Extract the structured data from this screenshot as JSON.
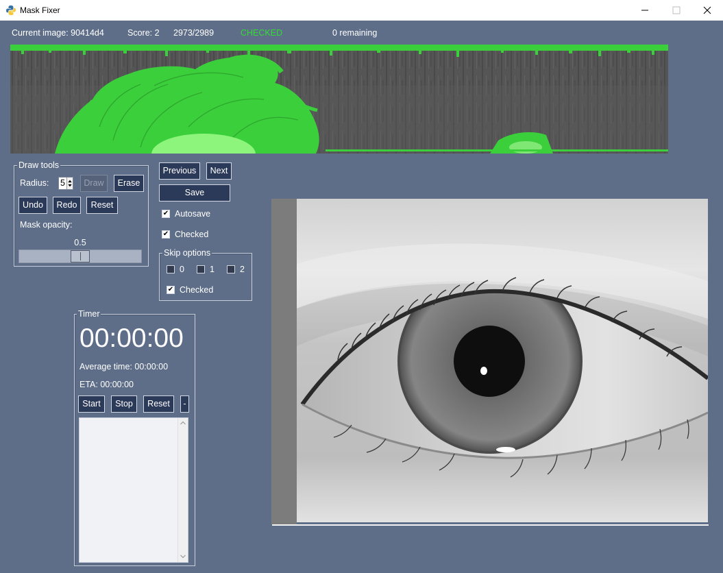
{
  "window": {
    "title": "Mask Fixer"
  },
  "status": {
    "current_image": "Current image: 90414d4",
    "score": "Score: 2",
    "progress": "2973/2989",
    "checked": "CHECKED",
    "remaining": "0 remaining"
  },
  "draw_tools": {
    "title": "Draw tools",
    "radius_label": "Radius:",
    "radius_value": "5",
    "draw": "Draw",
    "erase": "Erase",
    "undo": "Undo",
    "redo": "Redo",
    "reset": "Reset",
    "opacity_label": "Mask opacity:",
    "opacity_value": "0.5",
    "opacity": 0.5
  },
  "navigation": {
    "previous": "Previous",
    "next": "Next",
    "save": "Save",
    "autosave": {
      "label": "Autosave",
      "checked": true
    },
    "checked": {
      "label": "Checked",
      "checked": true
    }
  },
  "skip_options": {
    "title": "Skip options",
    "options": [
      {
        "label": "0",
        "checked": false
      },
      {
        "label": "1",
        "checked": false
      },
      {
        "label": "2",
        "checked": false
      }
    ],
    "checked": {
      "label": "Checked",
      "checked": true
    }
  },
  "timer": {
    "title": "Timer",
    "time": "00:00:00",
    "average": "Average time: 00:00:00",
    "eta": "ETA: 00:00:00",
    "start": "Start",
    "stop": "Stop",
    "reset": "Reset",
    "collapse": "-",
    "log": ""
  },
  "icons": {
    "app": "python-logo-icon",
    "minimize": "minimize-icon",
    "maximize": "maximize-icon",
    "close": "close-icon",
    "radius_spin": "spin-arrows-icon",
    "scroll_up": "chevron-up-icon",
    "scroll_down": "chevron-down-icon"
  },
  "colors": {
    "background": "#5e6e89",
    "button": "#2c3a5a",
    "checked_status": "#33dd33",
    "mask": "#3ccf3c"
  }
}
